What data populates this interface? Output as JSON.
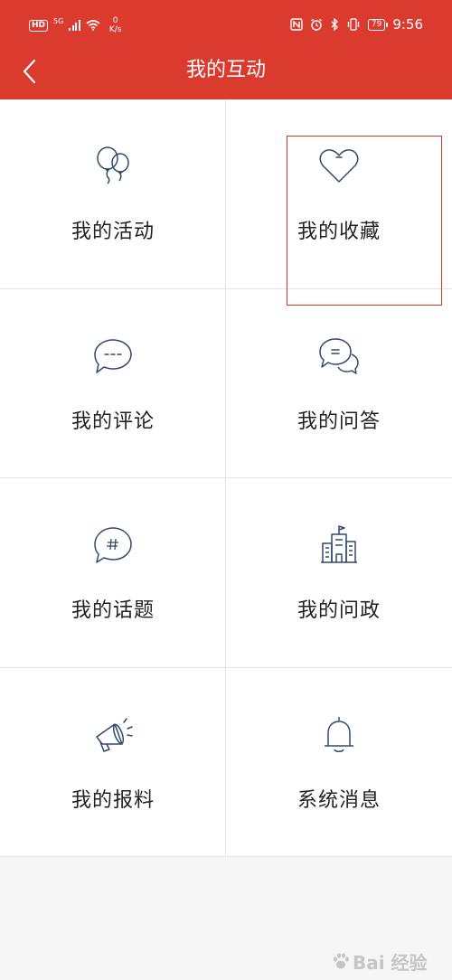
{
  "status_bar": {
    "hd": "HD",
    "network": "5G",
    "speed_value": "0",
    "speed_unit": "K/s",
    "battery": "79",
    "time": "9:56"
  },
  "header": {
    "title": "我的互动"
  },
  "grid_items": [
    {
      "label": "我的活动",
      "icon": "balloons-icon"
    },
    {
      "label": "我的收藏",
      "icon": "heart-icon"
    },
    {
      "label": "我的评论",
      "icon": "comment-icon"
    },
    {
      "label": "我的问答",
      "icon": "qa-chat-icon"
    },
    {
      "label": "我的话题",
      "icon": "topic-hash-icon"
    },
    {
      "label": "我的问政",
      "icon": "government-building-icon"
    },
    {
      "label": "我的报料",
      "icon": "megaphone-icon"
    },
    {
      "label": "系统消息",
      "icon": "bell-icon"
    }
  ],
  "colors": {
    "header_bg": "#db3a2f",
    "icon_stroke": "#2f4a6b",
    "highlight": "#e0322e"
  },
  "watermark": {
    "text": "Bai 经验"
  }
}
